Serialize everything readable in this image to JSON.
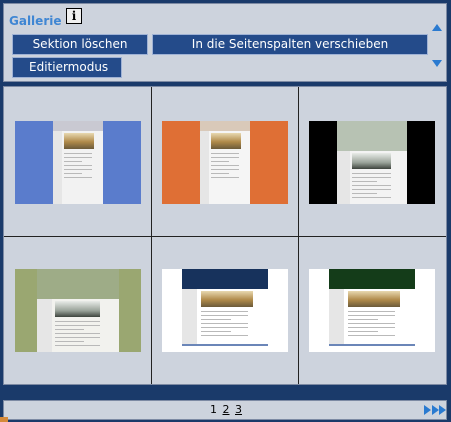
{
  "header": {
    "title": "Gallerie",
    "info_label": "i",
    "delete_label": "Sektion löschen",
    "move_label": "In die Seitenspalten verschieben",
    "edit_label": "Editiermodus"
  },
  "gallery": {
    "thumbnails": [
      {
        "name": "theme-blue",
        "side_color": "#5a7ccc",
        "page_color": "#f2f2f2",
        "header_color": "#c9c9d2",
        "photo": "beach"
      },
      {
        "name": "theme-orange",
        "side_color": "#df6f35",
        "page_color": "#f5f5f5",
        "header_color": "#d9c9b9",
        "photo": "beach"
      },
      {
        "name": "theme-black",
        "side_color": "#000000",
        "page_color": "#f3f3f3",
        "header_color": "#b7c2b3",
        "photo": "chairs"
      },
      {
        "name": "theme-olive",
        "side_color": "#9aa771",
        "page_color": "#f2f2ee",
        "header_color": "#9eac87",
        "photo": "chairs"
      },
      {
        "name": "theme-navy-white",
        "side_color": "#ffffff",
        "page_color": "#ffffff",
        "header_color": "#17325c",
        "photo": "beach"
      },
      {
        "name": "theme-green-white",
        "side_color": "#ffffff",
        "page_color": "#ffffff",
        "header_color": "#143c19",
        "photo": "beach"
      }
    ]
  },
  "pager": {
    "current": "1",
    "page2": "2",
    "page3": "3"
  }
}
